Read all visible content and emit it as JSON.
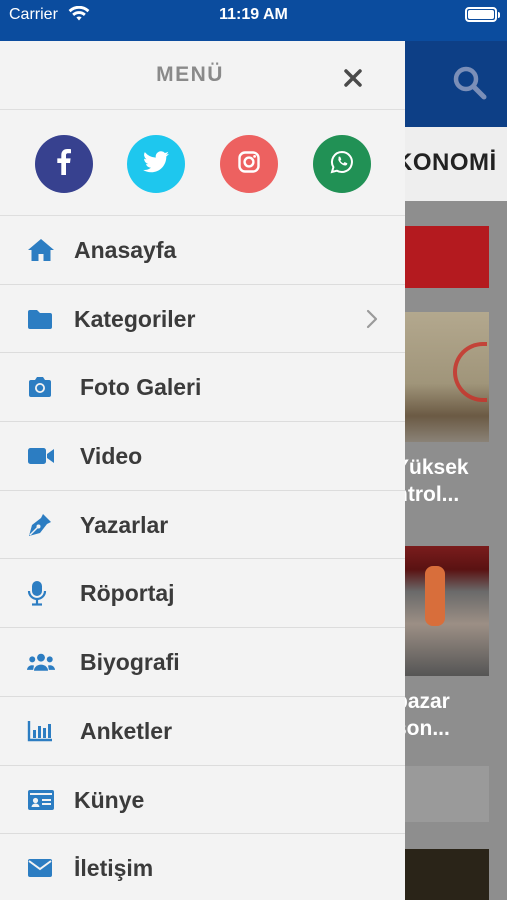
{
  "status_bar": {
    "carrier": "Carrier",
    "time": "11:19 AM",
    "battery_level": 1.0
  },
  "background_app": {
    "header_icon": "search-icon",
    "tab_label": "KONOMİ",
    "headline_1_line_1": "Yüksek",
    "headline_1_line_2": "ntrol...",
    "headline_2_line_1": "pazar",
    "headline_2_line_2": "son..."
  },
  "menu": {
    "title": "MENÜ",
    "close_icon": "close-icon",
    "socials": [
      {
        "name": "facebook",
        "icon": "facebook-icon",
        "color": "#37418f"
      },
      {
        "name": "twitter",
        "icon": "twitter-icon",
        "color": "#1ec7ee"
      },
      {
        "name": "instagram",
        "icon": "instagram-icon",
        "color": "#ed6160"
      },
      {
        "name": "whatsapp",
        "icon": "whatsapp-icon",
        "color": "#219155"
      }
    ],
    "items": [
      {
        "label": "Anasayfa",
        "icon": "home-icon"
      },
      {
        "label": "Kategoriler",
        "icon": "folder-icon",
        "has_submenu": true
      },
      {
        "label": "Foto Galeri",
        "icon": "camera-icon"
      },
      {
        "label": "Video",
        "icon": "video-icon"
      },
      {
        "label": "Yazarlar",
        "icon": "pen-nib-icon"
      },
      {
        "label": "Röportaj",
        "icon": "microphone-icon"
      },
      {
        "label": "Biyografi",
        "icon": "users-icon"
      },
      {
        "label": "Anketler",
        "icon": "bar-chart-icon"
      },
      {
        "label": "Künye",
        "icon": "id-card-icon"
      },
      {
        "label": "İletişim",
        "icon": "envelope-icon"
      }
    ]
  },
  "colors": {
    "status_bar_bg": "#0b4c9e",
    "menu_bg": "#f3f3f3",
    "menu_icon_accent": "#2c7dc2",
    "menu_text": "#3b3b3b",
    "menu_title": "#8a8a8a"
  }
}
